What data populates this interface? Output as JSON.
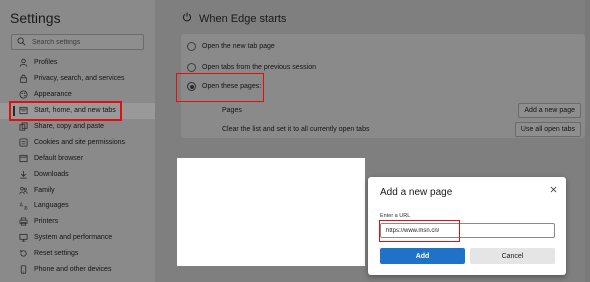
{
  "sidebar": {
    "title": "Settings",
    "search_placeholder": "Search settings",
    "items": [
      {
        "label": "Profiles",
        "icon": "profile-icon"
      },
      {
        "label": "Privacy, search, and services",
        "icon": "lock-icon"
      },
      {
        "label": "Appearance",
        "icon": "appearance-icon"
      },
      {
        "label": "Start, home, and new tabs",
        "icon": "home-tabs-icon",
        "selected": true
      },
      {
        "label": "Share, copy and paste",
        "icon": "share-icon"
      },
      {
        "label": "Cookies and site permissions",
        "icon": "cookies-icon"
      },
      {
        "label": "Default browser",
        "icon": "browser-icon"
      },
      {
        "label": "Downloads",
        "icon": "download-icon"
      },
      {
        "label": "Family",
        "icon": "family-icon"
      },
      {
        "label": "Languages",
        "icon": "language-icon"
      },
      {
        "label": "Printers",
        "icon": "printer-icon"
      },
      {
        "label": "System and performance",
        "icon": "system-icon"
      },
      {
        "label": "Reset settings",
        "icon": "reset-icon"
      },
      {
        "label": "Phone and other devices",
        "icon": "phone-icon"
      }
    ]
  },
  "main": {
    "section_title": "When Edge starts",
    "options": [
      {
        "label": "Open the new tab page",
        "checked": false
      },
      {
        "label": "Open tabs from the previous session",
        "checked": false
      },
      {
        "label": "Open these pages:",
        "checked": true
      }
    ],
    "pages_label": "Pages",
    "add_page_button": "Add a new page",
    "clear_label": "Clear the list and set it to all currently open tabs",
    "use_all_tabs_button": "Use all open tabs"
  },
  "dialog": {
    "title": "Add a new page",
    "url_label": "Enter a URL",
    "url_value": "https://www.msn.cn/",
    "add_button": "Add",
    "cancel_button": "Cancel"
  },
  "colors": {
    "accent": "#1f72c7",
    "highlight": "#e01010"
  }
}
